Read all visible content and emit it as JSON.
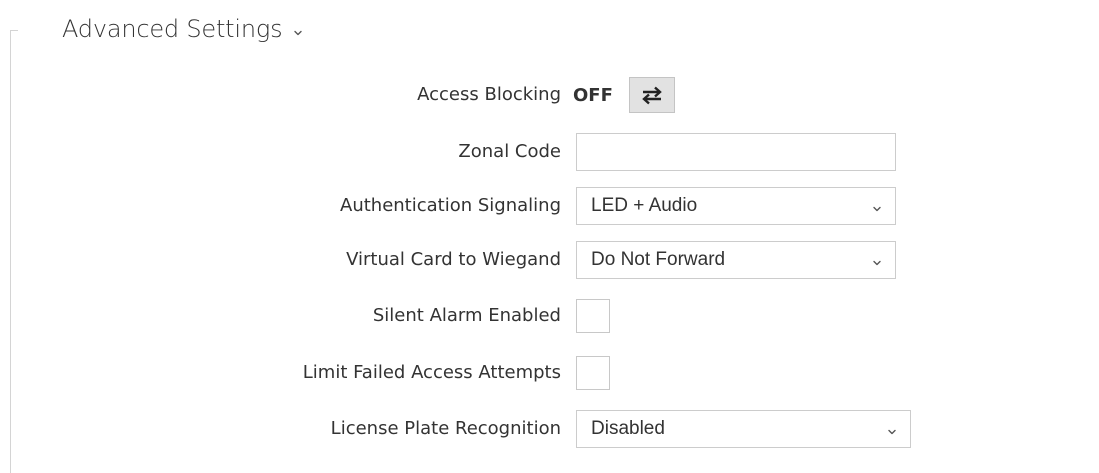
{
  "section": {
    "title": "Advanced Settings",
    "expand_icon": "chevron-down-icon"
  },
  "access_blocking": {
    "label": "Access Blocking",
    "state": "OFF",
    "toggle_icon": "swap-arrows-icon"
  },
  "zonal_code": {
    "label": "Zonal Code",
    "value": "",
    "placeholder": ""
  },
  "authentication_signaling": {
    "label": "Authentication Signaling",
    "selected": "LED + Audio"
  },
  "virtual_card_to_wiegand": {
    "label": "Virtual Card to Wiegand",
    "selected": "Do Not Forward"
  },
  "silent_alarm_enabled": {
    "label": "Silent Alarm Enabled",
    "checked": false
  },
  "limit_failed_access_attempts": {
    "label": "Limit Failed Access Attempts",
    "checked": false
  },
  "license_plate_recognition": {
    "label": "License Plate Recognition",
    "selected": "Disabled"
  },
  "colors": {
    "text": "#333333",
    "border": "#cccccc",
    "toggle_bg": "#e2e2e2"
  }
}
